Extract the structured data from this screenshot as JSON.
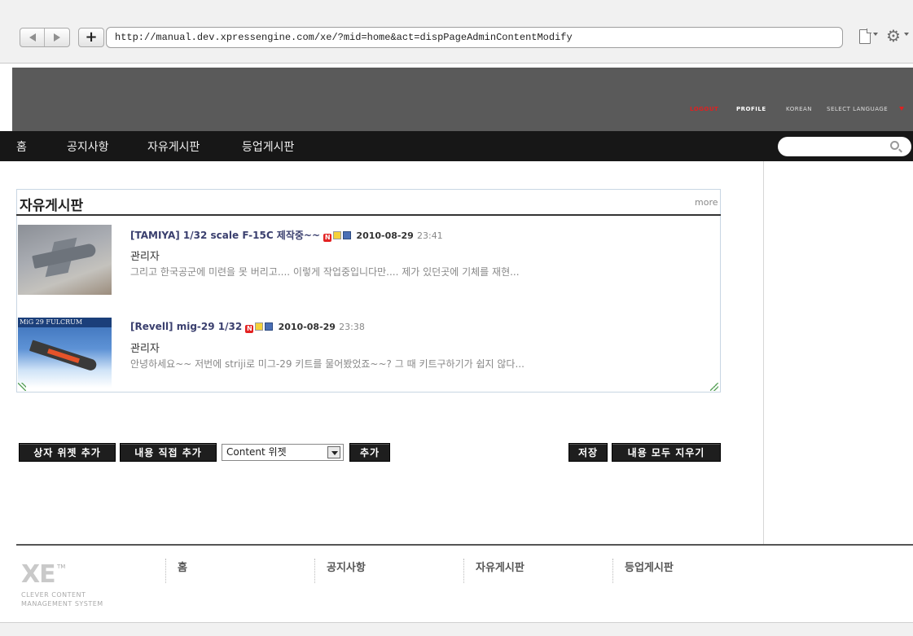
{
  "browser": {
    "url": "http://manual.dev.xpressengine.com/xe/?mid=home&act=dispPageAdminContentModify",
    "plus_label": "+"
  },
  "header": {
    "logout": "LOGOUT",
    "profile": "PROFILE",
    "korean": "KOREAN",
    "select_language": "SELECT LANGUAGE"
  },
  "nav": {
    "items": [
      "홈",
      "공지사항",
      "자유게시판",
      "등업게시판"
    ]
  },
  "widget": {
    "title": "자유게시판",
    "more": "more",
    "posts": [
      {
        "title": "[TAMIYA] 1/32 scale F-15C 제작중~~",
        "date": "2010-08-29",
        "time": "23:41",
        "author": "관리자",
        "excerpt": "그리고 한국공군에 미련을 못 버리고.... 이렇게 작업중입니다만.... 제가 있던곳에 기체를 재현...",
        "badge_new": "N"
      },
      {
        "title": "[Revell] mig-29 1/32",
        "date": "2010-08-29",
        "time": "23:38",
        "author": "관리자",
        "excerpt": "안녕하세요~~ 저번에 striji로 미그-29 키트를 물어봤었죠~~? 그 때 키트구하기가 쉽지 않다...",
        "badge_new": "N",
        "thumb_caption": "MiG 29 FULCRUM"
      }
    ]
  },
  "actions": {
    "add_box_widget": "상자 위젯 추가",
    "add_content_direct": "내용 직접 추가",
    "content_select": "Content 위젯",
    "add": "추가",
    "save": "저장",
    "clear_all": "내용 모두 지우기"
  },
  "footer": {
    "logo": "XE",
    "tm": "TM",
    "tagline_1": "CLEVER CONTENT",
    "tagline_2": "MANAGEMENT SYSTEM",
    "nav": [
      "홈",
      "공지사항",
      "자유게시판",
      "등업게시판"
    ]
  },
  "colors": {
    "header_bg": "#5a5a5a",
    "gnb_bg": "#171717",
    "logout": "#e02020",
    "button_bg": "#1e1e1e"
  }
}
